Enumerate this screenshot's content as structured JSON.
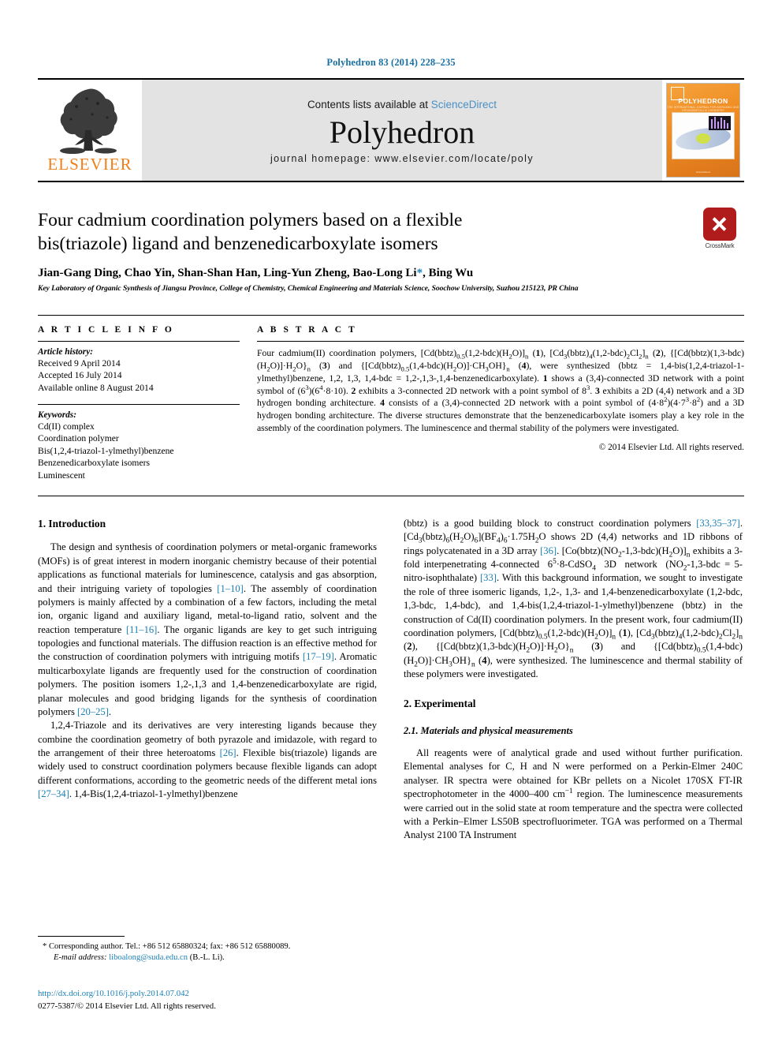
{
  "running_head": "Polyhedron 83 (2014) 228–235",
  "masthead": {
    "publisher": "ELSEVIER",
    "contents_prefix": "Contents lists available at ",
    "contents_link": "ScienceDirect",
    "journal_title": "Polyhedron",
    "homepage": "journal homepage: www.elsevier.com/locate/poly",
    "cover_title": "POLYHEDRON",
    "cover_subtitle": "THE INTERNATIONAL JOURNAL FOR INORGANIC AND ORGANOMETALLIC CHEMISTRY",
    "cover_footer": "ScienceDirect"
  },
  "article": {
    "title": "Four cadmium coordination polymers based on a flexible bis(triazole) ligand and benzenedicarboxylate isomers",
    "authors": "Jian-Gang Ding, Chao Yin, Shan-Shan Han, Ling-Yun Zheng, Bao-Long Li",
    "authors_tail": ", Bing Wu",
    "corresponding_marker": "*",
    "affiliation": "Key Laboratory of Organic Synthesis of Jiangsu Province, College of Chemistry, Chemical Engineering and Materials Science, Soochow University, Suzhou 215123, PR China",
    "crossmark_label": "CrossMark"
  },
  "article_info": {
    "heading": "A R T I C L E  I N F O",
    "history_heading": "Article history:",
    "history": [
      "Received 9 April 2014",
      "Accepted 16 July 2014",
      "Available online 8 August 2014"
    ],
    "keywords_heading": "Keywords:",
    "keywords": [
      "Cd(II) complex",
      "Coordination polymer",
      "Bis(1,2,4-triazol-1-ylmethyl)benzene",
      "Benzenedicarboxylate isomers",
      "Luminescent"
    ]
  },
  "abstract": {
    "heading": "A B S T R A C T",
    "copyright": "© 2014 Elsevier Ltd. All rights reserved."
  },
  "sections": {
    "introduction_heading": "1. Introduction",
    "experimental_heading": "2. Experimental",
    "materials_heading": "2.1. Materials and physical measurements"
  },
  "footnote": {
    "corresponding": "* Corresponding author. Tel.: +86 512 65880324; fax: +86 512 65880089.",
    "email_label": "E-mail address:",
    "email": "liboalong@suda.edu.cn",
    "email_owner": "(B.-L. Li)."
  },
  "bottom": {
    "doi": "http://dx.doi.org/10.1016/j.poly.2014.07.042",
    "issn": "0277-5387/© 2014 Elsevier Ltd. All rights reserved."
  }
}
